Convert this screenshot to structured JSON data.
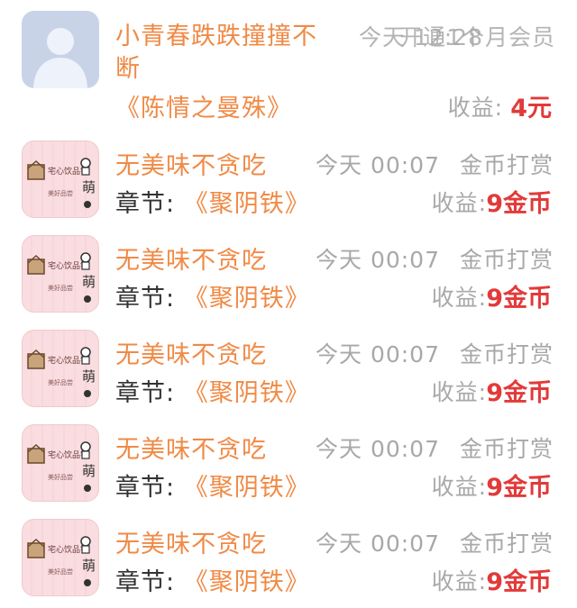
{
  "first_item": {
    "username": "小青春跌跌撞撞不",
    "username_cont": "断",
    "time": "今天 12:28",
    "action": "开通1个月会员",
    "book": "《陈情之曼殊》",
    "earnings_label": "收益:",
    "earnings_value": "4元"
  },
  "items": [
    {
      "username": "无美味不贪吃",
      "time": "今天 00:07",
      "action": "金币打赏",
      "chapter_label": "章节:",
      "book": "《聚阴铁》",
      "earnings_label": "收益:",
      "earnings_value": "9金币"
    },
    {
      "username": "无美味不贪吃",
      "time": "今天 00:07",
      "action": "金币打赏",
      "chapter_label": "章节:",
      "book": "《聚阴铁》",
      "earnings_label": "收益:",
      "earnings_value": "9金币"
    },
    {
      "username": "无美味不贪吃",
      "time": "今天 00:07",
      "action": "金币打赏",
      "chapter_label": "章节:",
      "book": "《聚阴铁》",
      "earnings_label": "收益:",
      "earnings_value": "9金币"
    },
    {
      "username": "无美味不贪吃",
      "time": "今天 00:07",
      "action": "金币打赏",
      "chapter_label": "章节:",
      "book": "《聚阴铁》",
      "earnings_label": "收益:",
      "earnings_value": "9金币"
    },
    {
      "username": "无美味不贪吃",
      "time": "今天 00:07",
      "action": "金币打赏",
      "chapter_label": "章节:",
      "book": "《聚阴铁》",
      "earnings_label": "收益:",
      "earnings_value": "9金币"
    }
  ]
}
